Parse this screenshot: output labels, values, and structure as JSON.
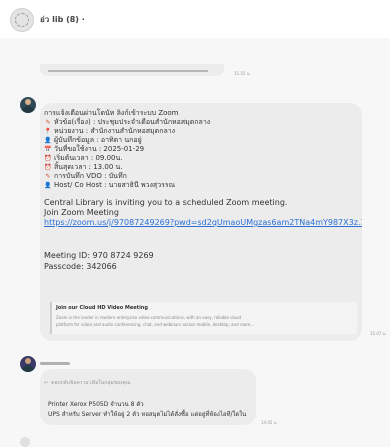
{
  "header": {
    "group_name": "อ่ว lib (8) ·"
  },
  "messages": [
    {
      "time": "15.55 น."
    },
    {
      "lines": [
        {
          "icon": "",
          "text": "การแจ้งเตือนผ่านโดนัท ลิงก์เข้าระบบ Zoom"
        },
        {
          "icon": "pencil",
          "text": "หัวข้อ(เรื่อง) : ประชุมประจำเดือนสำนักหอสมุดกลาง"
        },
        {
          "icon": "pin",
          "text": "หน่วยงาน : สำนักงานสำนักหอสมุดกลาง"
        },
        {
          "icon": "person",
          "text": "ผู้บันทึกข้อมูล : อาทิตา นกอยู่"
        },
        {
          "icon": "calendar",
          "text": "วันที่ขอใช้งาน : 2025-01-29"
        },
        {
          "icon": "clock",
          "text": "เริ่มต้นเวลา : 09.00น."
        },
        {
          "icon": "clock",
          "text": "สิ้นสุดเวลา : 13.00 น."
        },
        {
          "icon": "pencil",
          "text": "การบันทึก VDO : บันทึก"
        },
        {
          "icon": "person",
          "text": "Host/ Co Host : นายสาธินี พวงสุวรรณ"
        }
      ],
      "invite_text": "Central Library is inviting you to a scheduled Zoom meeting.",
      "join_text": "Join Zoom Meeting",
      "url": "https://zoom.us/j/97087249269?pwd=sd2qUmaoUMgzas6am2TNa4mY987X3z.1",
      "meeting_id": "Meeting ID: 970 8724 9269",
      "passcode": "Passcode: 342066",
      "preview": {
        "title": "Join our Cloud HD Video Meeting",
        "desc1": "Zoom is the leader in modern enterprise video communications, with an easy, reliable cloud",
        "desc2": "platform for video and audio conferencing, chat, and webinars across mobile, desktop, and room..."
      },
      "time": "15.07 น."
    },
    {
      "reply_to": "ตอบกลับข้อความ เดิมในกลุ่มของคุณ",
      "lines": [
        "Printer Xerox P505D จำนวน 8 ตัว",
        "UPS สำหรับ Server ทำให้อยู่ 2 ตัว หอสมุดไม่ได้สั่งซื้อ แต่อยู่ที่ห้องไอที/ใดใน"
      ],
      "time": "14.05 น."
    }
  ],
  "colors": {
    "bubble": "#ececec",
    "link": "#2a6fd6",
    "background": "#f7f7f7"
  }
}
